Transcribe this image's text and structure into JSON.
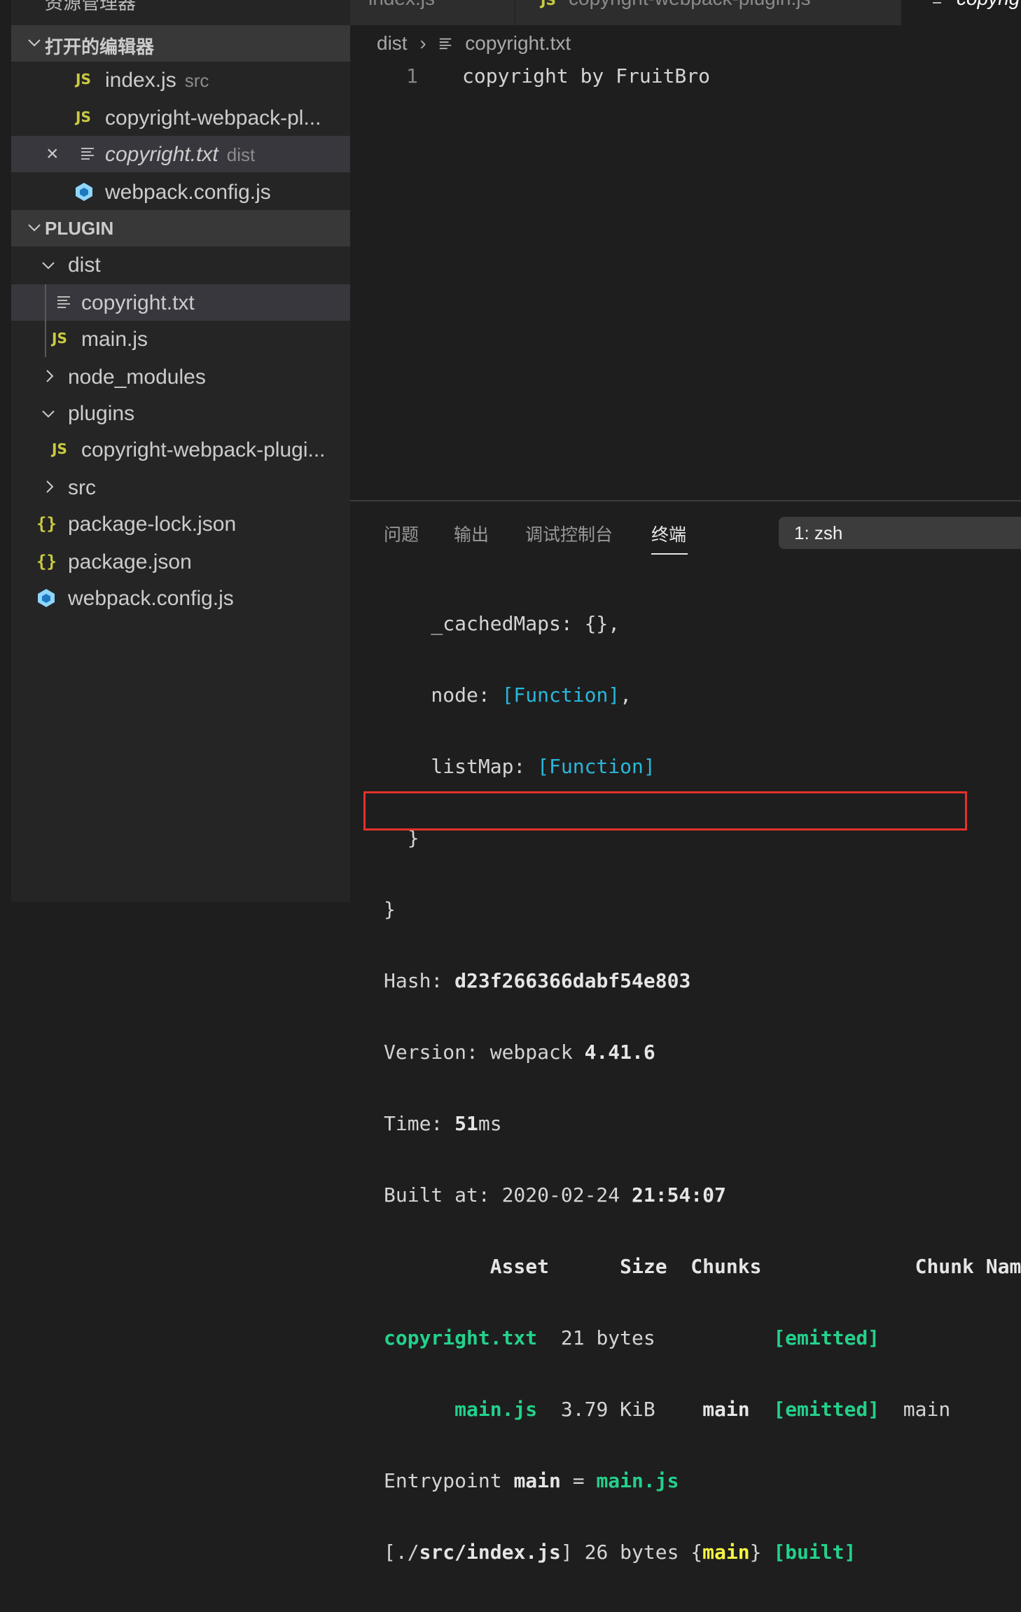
{
  "sidebar": {
    "title": "资源管理器",
    "open_editors": {
      "header": "打开的编辑器",
      "items": [
        {
          "icon": "JS",
          "name": "index.js",
          "desc": "src"
        },
        {
          "icon": "JS",
          "name": "copyright-webpack-pl...",
          "desc": ""
        },
        {
          "icon": "text-file-icon",
          "name": "copyright.txt",
          "desc": "dist",
          "close": "×"
        },
        {
          "icon": "webpack-icon",
          "name": "webpack.config.js",
          "desc": ""
        }
      ]
    },
    "project": {
      "header": "PLUGIN",
      "items": [
        {
          "name": "dist"
        },
        {
          "name": "copyright.txt"
        },
        {
          "icon": "JS",
          "name": "main.js"
        },
        {
          "name": "node_modules"
        },
        {
          "name": "plugins"
        },
        {
          "icon": "JS",
          "name": "copyright-webpack-plugi..."
        },
        {
          "name": "src"
        },
        {
          "icon": "{}",
          "name": "package-lock.json"
        },
        {
          "icon": "{}",
          "name": "package.json"
        },
        {
          "icon": "webpack-icon",
          "name": "webpack.config.js"
        }
      ]
    }
  },
  "editor": {
    "tabs": [
      {
        "label": "index.js",
        "icon": "JS"
      },
      {
        "label": "copyright-webpack-plugin.js",
        "icon": "JS"
      },
      {
        "label": "copyrig",
        "icon": "text-file-icon"
      }
    ],
    "breadcrumb": {
      "folder": "dist",
      "sep": "›",
      "file": "copyright.txt"
    },
    "line_number": "1",
    "code": "copyright by FruitBro"
  },
  "panel": {
    "tabs": [
      "问题",
      "输出",
      "调试控制台",
      "终端"
    ],
    "active_tab": "终端",
    "terminal_select": "1: zsh",
    "output": {
      "l1": "    _cachedMaps: {},",
      "l2a": "    node: ",
      "l2b": "[Function]",
      "l2c": ",",
      "l3a": "    listMap: ",
      "l3b": "[Function]",
      "l4": "  }",
      "l5": "}",
      "hash_label": "Hash: ",
      "hash_value": "d23f266366dabf54e803",
      "version_label": "Version: webpack ",
      "version_value": "4.41.6",
      "time_label": "Time: ",
      "time_value": "51",
      "time_unit": "ms",
      "built_label": "Built at: 2020-02-24 ",
      "built_time": "21:54:07",
      "table_header": "         Asset      Size  Chunks             Chunk Names",
      "asset1_name": "copyright.txt",
      "asset1_size": "  21 bytes          ",
      "asset1_status": "[emitted]",
      "asset2_pad": "      ",
      "asset2_name": "main.js",
      "asset2_size": "  3.79 KiB    ",
      "asset2_chunk": "main",
      "asset2_pad2": "  ",
      "asset2_status": "[emitted]",
      "asset2_names": "  main",
      "entry_label": "Entrypoint ",
      "entry_name": "main",
      "entry_eq": " = ",
      "entry_file": "main.js",
      "mod_path_a": "[./",
      "mod_path_b": "src/index.js",
      "mod_path_c": "] 26 bytes {",
      "mod_chunk": "main",
      "mod_close": "} ",
      "mod_status": "[built]"
    }
  },
  "colors": {
    "accent_green": "#23d18b",
    "accent_cyan": "#29b8db",
    "accent_yellow": "#f5f543",
    "highlight_box": "#e3322b"
  }
}
